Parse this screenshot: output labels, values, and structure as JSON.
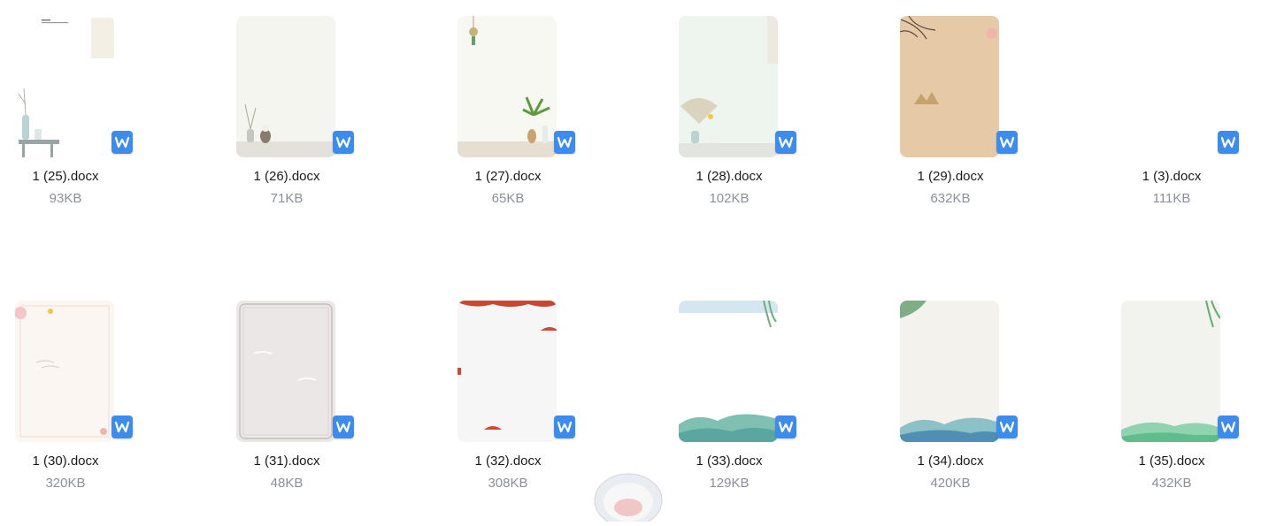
{
  "files": [
    {
      "name": "1 (25).docx",
      "size": "93KB",
      "icon": "word-doc-icon"
    },
    {
      "name": "1 (26).docx",
      "size": "71KB",
      "icon": "word-doc-icon"
    },
    {
      "name": "1 (27).docx",
      "size": "65KB",
      "icon": "word-doc-icon"
    },
    {
      "name": "1 (28).docx",
      "size": "102KB",
      "icon": "word-doc-icon"
    },
    {
      "name": "1 (29).docx",
      "size": "632KB",
      "icon": "word-doc-icon"
    },
    {
      "name": "1 (3).docx",
      "size": "111KB",
      "icon": "word-doc-icon"
    },
    {
      "name": "1 (30).docx",
      "size": "320KB",
      "icon": "word-doc-icon"
    },
    {
      "name": "1 (31).docx",
      "size": "48KB",
      "icon": "word-doc-icon"
    },
    {
      "name": "1 (32).docx",
      "size": "308KB",
      "icon": "word-doc-icon"
    },
    {
      "name": "1 (33).docx",
      "size": "129KB",
      "icon": "word-doc-icon"
    },
    {
      "name": "1 (34).docx",
      "size": "420KB",
      "icon": "word-doc-icon"
    },
    {
      "name": "1 (35).docx",
      "size": "432KB",
      "icon": "word-doc-icon"
    }
  ],
  "colors": {
    "word_icon_blue": "#3c8cf0",
    "file_name_text": "#1a1a1a",
    "file_size_text": "#8a8f99"
  }
}
